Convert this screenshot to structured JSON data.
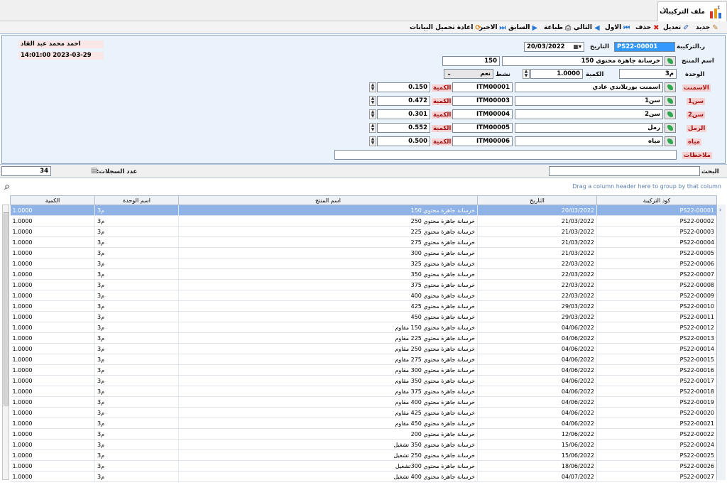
{
  "tab": {
    "title": "ملف التركيبات",
    "close": "X"
  },
  "toolbar": {
    "new": "جديد",
    "edit": "تعديل",
    "delete": "حذف",
    "first": "الاول",
    "next": "التالي",
    "print": "طباعة",
    "prev": "السابق",
    "last": "الاخير",
    "reload": "اعادة تحميل البيانات"
  },
  "form": {
    "comp_no_label": "ر.التركيبة",
    "comp_no": "PS22-00001",
    "date_label": "التاريخ",
    "date": "20/03/2022",
    "product_label": "اسم المنتج",
    "product_name": "خرسانة جاهزة محتوي 150",
    "product_code": "150",
    "unit_label": "الوحدة",
    "unit": "م3",
    "qty_label": "الكمية",
    "qty": "1.0000",
    "active_label": "نشط",
    "active": "نعم",
    "user": "احمد محمد عبد القاد",
    "timestamp": "14:01:00 2023-03-29",
    "notes_label": "ملاحظات",
    "notes": "",
    "components": [
      {
        "label": "الاسمنت",
        "name": "اسمنت بورتلاندي عادي",
        "code": "ITM00001",
        "qty_label": "الكمية",
        "qty": "0.150"
      },
      {
        "label": "سن1",
        "name": "سن1",
        "code": "ITM00003",
        "qty_label": "الكمية",
        "qty": "0.472"
      },
      {
        "label": "سن2",
        "name": "سن2",
        "code": "ITM00004",
        "qty_label": "الكمية",
        "qty": "0.301"
      },
      {
        "label": "الرمل",
        "name": "رمل",
        "code": "ITM00005",
        "qty_label": "الكمية",
        "qty": "0.552"
      },
      {
        "label": "مياه",
        "name": "مياه",
        "code": "ITM00006",
        "qty_label": "الكمية",
        "qty": "0.500"
      }
    ]
  },
  "search": {
    "label": "البحث",
    "value": "",
    "count_label": "عدد السجلات:",
    "count": "34"
  },
  "grid": {
    "group_hint": "Drag a column header here to group by that column",
    "columns": [
      "كود التركيبة",
      "التاريخ",
      "اسم المنتج",
      "اسم الوحدة",
      "الكمية"
    ],
    "rows": [
      [
        "PS22-00001",
        "20/03/2022",
        "خرسانة جاهزة محتوي 150",
        "م3",
        "1.0000"
      ],
      [
        "PS22-00002",
        "21/03/2022",
        "خرسانة جاهزة محتوي 250",
        "م3",
        "1.0000"
      ],
      [
        "PS22-00003",
        "21/03/2022",
        "خرسانة جاهزة محتوي 225",
        "م3",
        "1.0000"
      ],
      [
        "PS22-00004",
        "21/03/2022",
        "خرسانة جاهزة محتوي 275",
        "م3",
        "1.0000"
      ],
      [
        "PS22-00005",
        "21/03/2022",
        "خرسانة جاهزة محتوي 300",
        "م3",
        "1.0000"
      ],
      [
        "PS22-00006",
        "22/03/2022",
        "خرسانة جاهزة محتوي 325",
        "م3",
        "1.0000"
      ],
      [
        "PS22-00007",
        "22/03/2022",
        "خرسانة جاهزة محتوي 350",
        "م3",
        "1.0000"
      ],
      [
        "PS22-00008",
        "22/03/2022",
        "خرسانة جاهزة محتوي 375",
        "م3",
        "1.0000"
      ],
      [
        "PS22-00009",
        "22/03/2022",
        "خرسانة جاهزة محتوي 400",
        "م3",
        "1.0000"
      ],
      [
        "PS22-00010",
        "29/03/2022",
        "خرسانة جاهزة محتوي 425",
        "م3",
        "1.0000"
      ],
      [
        "PS22-00011",
        "29/03/2022",
        "خرسانة جاهزة محتوي 450",
        "م3",
        "1.0000"
      ],
      [
        "PS22-00012",
        "04/06/2022",
        "خرسانة جاهزة محتوي 150 مقاوم",
        "م3",
        "1.0000"
      ],
      [
        "PS22-00013",
        "04/06/2022",
        "خرسانة جاهزة محتوي 225 مقاوم",
        "م3",
        "1.0000"
      ],
      [
        "PS22-00014",
        "04/06/2022",
        "خرسانة جاهزة محتوي 250 مقاوم",
        "م3",
        "1.0000"
      ],
      [
        "PS22-00015",
        "04/06/2022",
        "خرسانة جاهزة محتوي 275 مقاوم",
        "م3",
        "1.0000"
      ],
      [
        "PS22-00016",
        "04/06/2022",
        "خرسانة جاهزة محتوي 300 مقاوم",
        "م3",
        "1.0000"
      ],
      [
        "PS22-00017",
        "04/06/2022",
        "خرسانة جاهزة محتوي 350 مقاوم",
        "م3",
        "1.0000"
      ],
      [
        "PS22-00018",
        "04/06/2022",
        "خرسانة جاهزة محتوي 375 مقاوم",
        "م3",
        "1.0000"
      ],
      [
        "PS22-00019",
        "04/06/2022",
        "خرسانة جاهزة محتوي 400 مقاوم",
        "م3",
        "1.0000"
      ],
      [
        "PS22-00020",
        "04/06/2022",
        "خرسانة جاهزة محتوي 425 مقاوم",
        "م3",
        "1.0000"
      ],
      [
        "PS22-00021",
        "04/06/2022",
        "خرسانة جاهزة محتوي 450 مقاوم",
        "م3",
        "1.0000"
      ],
      [
        "PS22-00022",
        "12/06/2022",
        "خرسانة جاهزة محتوي 200",
        "م3",
        "1.0000"
      ],
      [
        "PS22-00024",
        "15/06/2022",
        "خرسانة جاهزة محتوي 350 تشغيل",
        "م3",
        "1.0000"
      ],
      [
        "PS22-00025",
        "15/06/2022",
        "خرسانة جاهزة محتوي 250 تشغيل",
        "م3",
        "1.0000"
      ],
      [
        "PS22-00026",
        "18/06/2022",
        "خرسانة جاهزة محتوي  300تشغيل",
        "م3",
        "1.0000"
      ],
      [
        "PS22-00027",
        "04/07/2022",
        "خرسانة جاهزة محتوي 400 تشغيل",
        "م3",
        "1.0000"
      ]
    ]
  }
}
